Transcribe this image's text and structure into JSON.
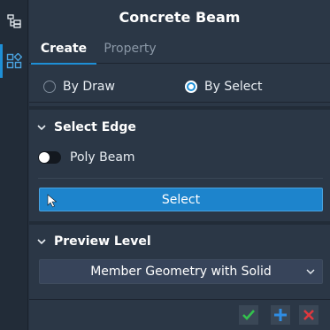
{
  "panel": {
    "title": "Concrete Beam"
  },
  "tabs": [
    {
      "label": "Create",
      "active": true
    },
    {
      "label": "Property",
      "active": false
    }
  ],
  "mode": {
    "options": [
      {
        "label": "By Draw",
        "selected": false
      },
      {
        "label": "By Select",
        "selected": true
      }
    ]
  },
  "select_edge": {
    "heading": "Select Edge",
    "toggle_label": "Poly Beam",
    "toggle_on": false,
    "button_label": "Select"
  },
  "preview_level": {
    "heading": "Preview Level",
    "selected": "Member Geometry with Solid"
  },
  "colors": {
    "accent": "#1e8fd6",
    "ok": "#33c24d",
    "add": "#2f8de4",
    "close": "#e0383e"
  },
  "icons": {
    "rail": [
      "tree-view-icon",
      "components-icon"
    ],
    "footer": [
      "check-icon",
      "plus-icon",
      "close-icon"
    ]
  }
}
